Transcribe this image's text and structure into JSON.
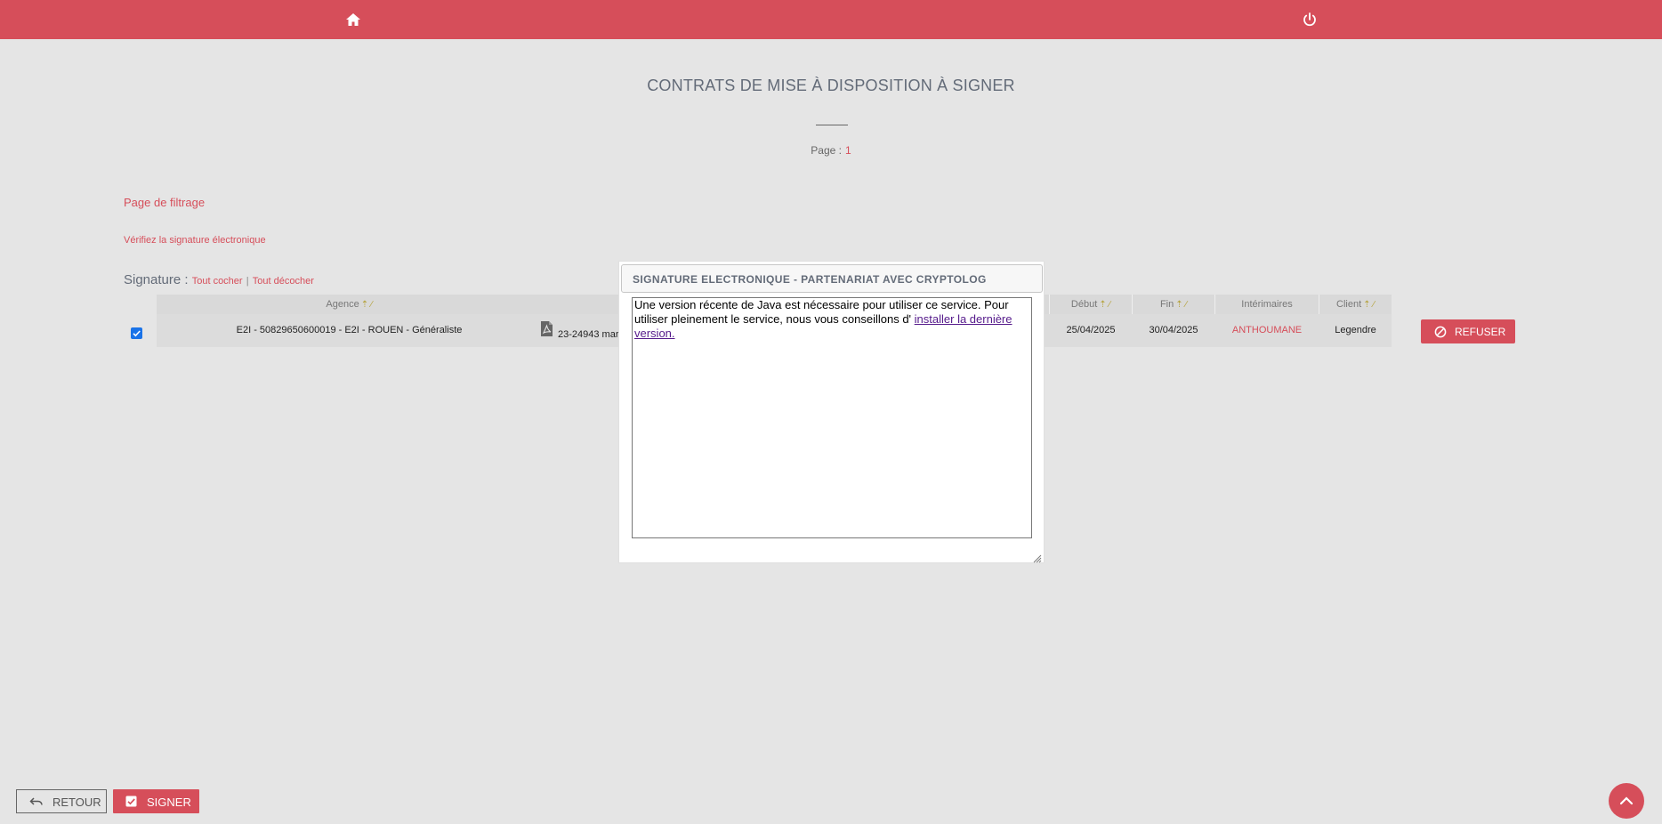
{
  "topbar": {
    "background": "#d64e5a",
    "home_icon": "home-icon",
    "power_icon": "power-icon"
  },
  "page": {
    "title": "CONTRATS DE MISE À DISPOSITION À SIGNER",
    "page_label": "Page :",
    "page_number": "1"
  },
  "links": {
    "filter": "Page de filtrage",
    "verify": "Vérifiez la signature électronique"
  },
  "signature": {
    "label": "Signature :",
    "check_all": "Tout cocher",
    "separator": "|",
    "uncheck_all": "Tout décocher"
  },
  "table": {
    "headers": {
      "agence": "Agence",
      "debut": "Début",
      "fin": "Fin",
      "interimaires": "Intérimaires",
      "client": "Client",
      "sort_glyph": "⇡ ∕"
    },
    "rows": [
      {
        "checked": true,
        "agence": "E2I - 50829650600019 - E2I - ROUEN - Généraliste",
        "contrat": "23-24943 mar",
        "debut": "25/04/2025",
        "fin": "30/04/2025",
        "interimaire": "ANTHOUMANE",
        "client": "Legendre",
        "refuse_label": "REFUSER"
      }
    ]
  },
  "modal": {
    "title": "SIGNATURE ELECTRONIQUE - PARTENARIAT AVEC CRYPTOLOG",
    "message": "Une version récente de Java est nécessaire pour utiliser ce service. Pour utiliser pleinement le service, nous vous conseillons d'",
    "link_text": "installer la dernière version."
  },
  "footer": {
    "back_label": "RETOUR",
    "sign_label": "SIGNER"
  },
  "colors": {
    "accent": "#d64e5a",
    "background": "#e5e5e5",
    "title_gray": "#636b78",
    "sort_arrow": "#b5a23a"
  }
}
